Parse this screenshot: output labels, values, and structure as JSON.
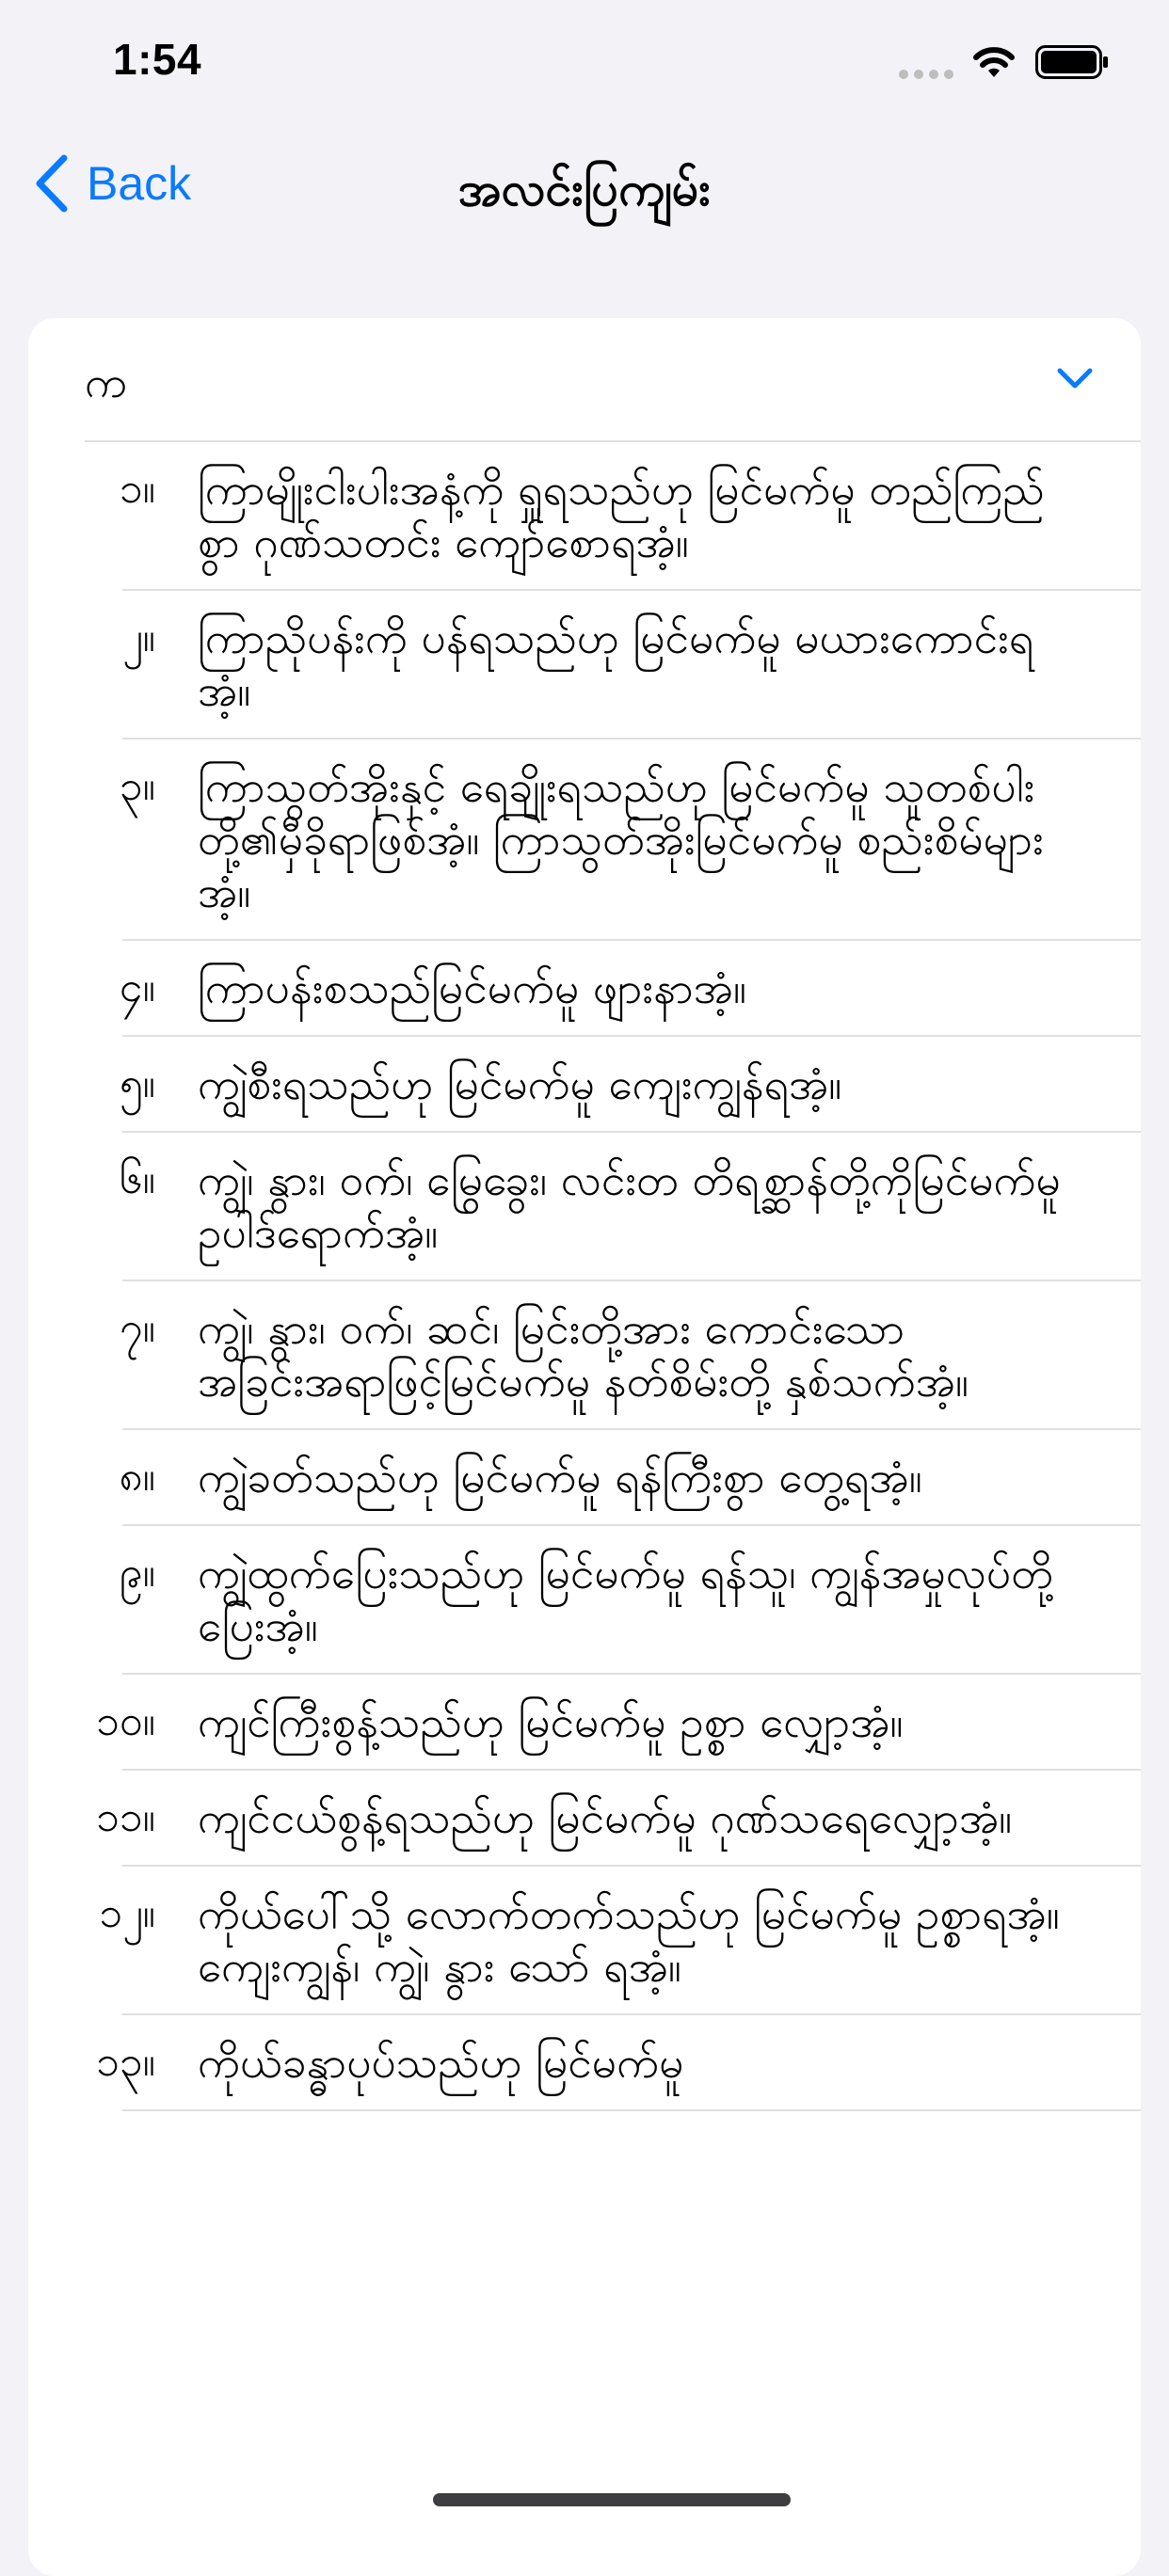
{
  "status_bar": {
    "time": "1:54"
  },
  "nav": {
    "back_label": "Back",
    "title": "အလင်းပြကျမ်း"
  },
  "section": {
    "letter": "က",
    "icon": "chevron-down-icon"
  },
  "entries": [
    {
      "num": "၁။",
      "text": "ကြာမျိုးငါးပါးအနံ့ကို ရှူရသည်ဟု မြင်မက်မူ တည်ကြည်စွာ ဂုဏ်သတင်း ကျော်စောရအံ့။"
    },
    {
      "num": "၂။",
      "text": "ကြာညိုပန်းကို ပန်ရသည်ဟု မြင်မက်မူ မယားကောင်းရအံ့။"
    },
    {
      "num": "၃။",
      "text": "ကြာသွတ်အိုးနှင့် ရေချိုးရသည်ဟု မြင်မက်မူ သူတစ်ပါးတို့၏မှီခိုရာဖြစ်အံ့။ ကြာသွတ်အိုးမြင်မက်မူ စည်းစိမ်များအံ့။"
    },
    {
      "num": "၄။",
      "text": "ကြာပန်းစသည်မြင်မက်မူ ဖျားနာအံ့။"
    },
    {
      "num": "၅။",
      "text": "ကျွဲစီးရသည်ဟု မြင်မက်မူ ကျေးကျွန်ရအံ့။"
    },
    {
      "num": "၆။",
      "text": "ကျွဲ၊ နွား၊ ဝက်၊ မြွေခွေး၊ လင်းတ တိရစ္ဆာန်တို့ကိုမြင်မက်မူ ဥပါဒ်ရောက်အံ့။"
    },
    {
      "num": "၇။",
      "text": "ကျွဲ၊ နွား၊ ဝက်၊ ဆင်၊ မြင်းတို့အား ကောင်းသော အခြင်းအရာဖြင့်မြင်မက်မူ နတ်စိမ်းတို့ နှစ်သက်အံ့။"
    },
    {
      "num": "၈။",
      "text": "ကျွဲခတ်သည်ဟု မြင်မက်မူ ရန်ကြီးစွာ တွေ့ရအံ့။"
    },
    {
      "num": "၉။",
      "text": "ကျွဲထွက်ပြေးသည်ဟု မြင်မက်မူ ရန်သူ၊ ကျွန်အမှုလုပ်တို့ ပြေးအံ့။"
    },
    {
      "num": "၁၀။",
      "text": "ကျင်ကြီးစွန့်သည်ဟု မြင်မက်မူ ဥစ္စာ လျှော့အံ့။"
    },
    {
      "num": "၁၁။",
      "text": "ကျင်ငယ်စွန့်ရသည်ဟု မြင်မက်မူ ဂုဏ်သရေလျှော့အံ့။"
    },
    {
      "num": "၁၂။",
      "text": "ကိုယ်ပေါ်သို့ လောက်တက်သည်ဟု မြင်မက်မူ ဥစ္စာရအံ့။ ကျေးကျွန်၊ ကျွဲ၊ နွား သော် ရအံ့။"
    },
    {
      "num": "၁၃။",
      "text": "ကိုယ်ခန္ဓာပုပ်သည်ဟု မြင်မက်မူ"
    }
  ]
}
